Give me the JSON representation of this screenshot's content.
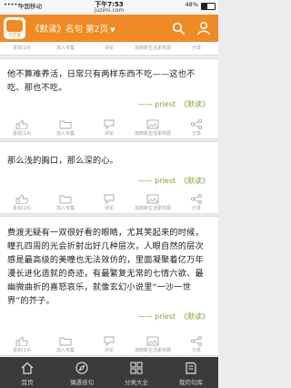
{
  "status": {
    "carrier": "中国移动",
    "time": "下午7:53",
    "url": "juzimi.com",
    "battery": "48%"
  },
  "navbar": {
    "logo_text": "句子迷",
    "title": "《默读》名句 第2页"
  },
  "cards": [
    {
      "quote": "他不算难养活，日常只有两样东西不吃——这也不吃、那也不吃。",
      "author": "—— priest",
      "book": "《默读》",
      "actions": [
        "喜欢(14)",
        "加入专集",
        "评论",
        "加到新生活素材源",
        "分享"
      ]
    },
    {
      "quote": "那么浅的胸口，那么深的心。",
      "author": "—— priest",
      "book": "《默读》",
      "actions": [
        "喜欢(14)",
        "加入专集",
        "评论",
        "加到新生活素材源",
        "分享"
      ]
    },
    {
      "quote": "费渡无疑有一双很好看的眼睛，尤其笑起来的时候，瞳孔四周的光会折射出好几种层次，人眼自然的层次感是最高级的美瞳也无法效仿的，里面凝聚着亿万年漫长进化造就的奇迹，有最繁复无常的七情六欲、最幽微曲折的喜怒哀乐，就像玄幻小说里“一沙一世界”的芥子。",
      "author": "—— priest",
      "book": "《默读》",
      "actions": [
        "喜欢(14)",
        "加入专集",
        "评论",
        "加到新生活素材源",
        "分享"
      ]
    }
  ],
  "top_actions": [
    "喜欢(14)",
    "加入专集",
    "评论",
    "加到新生活素材源",
    "分享"
  ],
  "tabbar": [
    "首页",
    "偶遇佳句",
    "分类大全",
    "我的句库"
  ],
  "colors": {
    "brand": "#f08a24",
    "author": "#7aa531",
    "tabbar": "#3b3b3b"
  }
}
